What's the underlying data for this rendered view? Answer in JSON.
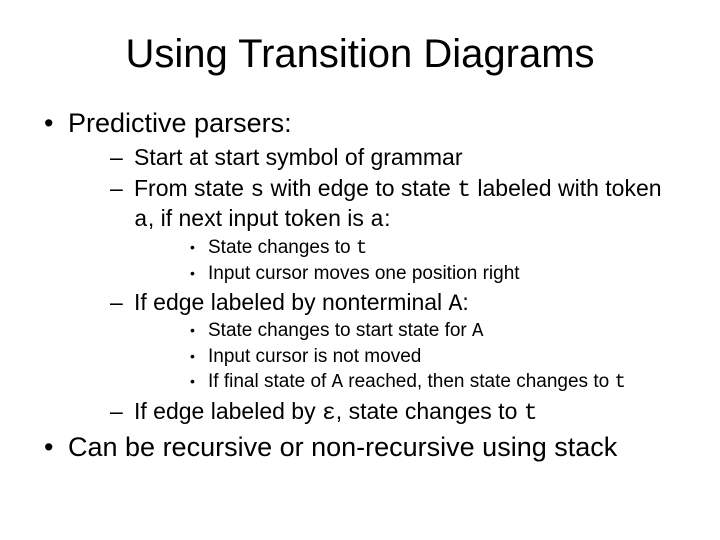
{
  "title": "Using Transition Diagrams",
  "b1": "Predictive parsers:",
  "b1_1": "Start at start symbol of grammar",
  "b1_2a": "From state ",
  "b1_2_s": "s",
  "b1_2b": " with edge to state ",
  "b1_2_t": "t",
  "b1_2c": " labeled with token ",
  "b1_2_a1": "a",
  "b1_2d": ", if next input token is ",
  "b1_2_a2": "a",
  "b1_2e": ":",
  "b1_2_i_a": "State changes to ",
  "b1_2_i_t": "t",
  "b1_2_ii": "Input cursor moves one position right",
  "b1_3a": "If edge labeled by nonterminal ",
  "b1_3_A": "A",
  "b1_3b": ":",
  "b1_3_i_a": "State changes to start state for ",
  "b1_3_i_A": "A",
  "b1_3_ii": "Input cursor is not moved",
  "b1_3_iii_a": "If final state of ",
  "b1_3_iii_A": "A",
  "b1_3_iii_b": " reached, then state changes to ",
  "b1_3_iii_t": "t",
  "b1_4a": "If edge labeled by ",
  "b1_4_eps": "ε",
  "b1_4b": ", state changes to ",
  "b1_4_t": "t",
  "b2": "Can be recursive or non-recursive using stack"
}
